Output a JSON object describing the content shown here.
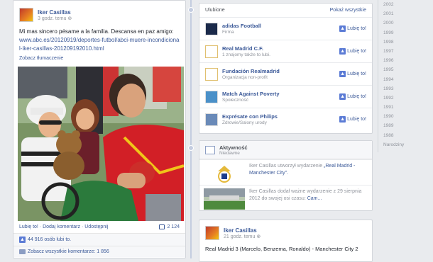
{
  "post": {
    "author": "Iker Casillas",
    "time": "3 godz. temu",
    "text": "Mi mas sincero pésame a la familia. Descansa en paz amigo:",
    "url": "www.abc.es/20120919/deportes-futbol/abci-muere-incondicional-iker-casillas-201209192010.html",
    "translate": "Zobacz tłumaczenie",
    "actions": {
      "like": "Lubię to!",
      "comment": "Dodaj komentarz",
      "share": "Udostępnij"
    },
    "share_count": "2 124",
    "likes_text": "44 916 osób lubi to.",
    "comments_text": "Zobacz wszystkie komentarze: 1 856"
  },
  "favorites": {
    "title": "Ulubione",
    "show_all": "Pokaż wszystkie",
    "like_label": "Lubię to!",
    "items": [
      {
        "name": "adidas Football",
        "sub": "Firma"
      },
      {
        "name": "Real Madrid C.F.",
        "sub": "1 znajomy także to lubi."
      },
      {
        "name": "Fundación Realmadrid",
        "sub": "Organizacja non-profit"
      },
      {
        "name": "Match Against Poverty",
        "sub": "Społeczność"
      },
      {
        "name": "Exprésate con Philips",
        "sub": "Zdrowie/Salony urody"
      }
    ]
  },
  "activity": {
    "title": "Aktywność",
    "subtitle": "Niedawne",
    "items": [
      {
        "prefix": "Iker Casillas utworzył wydarzenie ",
        "link": "„Real Madrid - Manchester City\".",
        "suffix": ""
      },
      {
        "prefix": "Iker Casillas dodał ważne wydarzenie z 29 sierpnia 2012 do swojej osi czasu: ",
        "link": "Cam...",
        "suffix": ""
      }
    ]
  },
  "post2": {
    "author": "Iker Casillas",
    "time": "21 godz. temu",
    "text": "Real Madrid 3 (Marcelo, Benzema, Ronaldo) - Manchester City 2"
  },
  "years": [
    "2002",
    "2001",
    "2000",
    "1999",
    "1998",
    "1997",
    "1996",
    "1995",
    "1994",
    "1993",
    "1992",
    "1991",
    "1990",
    "1989",
    "1988",
    "Narodziny"
  ]
}
